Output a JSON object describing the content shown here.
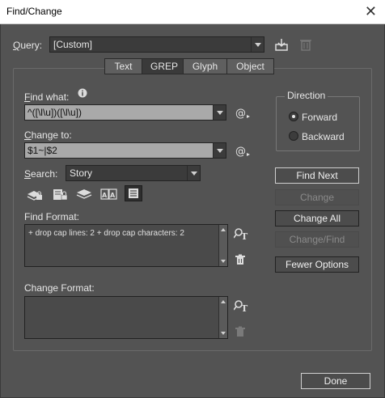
{
  "window": {
    "title": "Find/Change",
    "close_glyph": "✕"
  },
  "query": {
    "label": "Query:",
    "value": "[Custom]"
  },
  "tabs": [
    {
      "label": "Text",
      "active": false
    },
    {
      "label": "GREP",
      "active": true
    },
    {
      "label": "Glyph",
      "active": false
    },
    {
      "label": "Object",
      "active": false
    }
  ],
  "find_what": {
    "label": "Find what:",
    "value": "^([\\l\\u])([\\l\\u])",
    "info_icon": "info-icon"
  },
  "change_to": {
    "label": "Change to:",
    "value": "$1~|$2"
  },
  "search": {
    "label": "Search:",
    "value": "Story"
  },
  "direction": {
    "title": "Direction",
    "options": [
      {
        "label": "Forward",
        "selected": true
      },
      {
        "label": "Backward",
        "selected": false
      }
    ]
  },
  "buttons": {
    "find_next": "Find Next",
    "change": "Change",
    "change_all": "Change All",
    "change_find": "Change/Find",
    "fewer_options": "Fewer Options",
    "done": "Done"
  },
  "find_format": {
    "label": "Find Format:",
    "value": "+ drop cap lines:  2 + drop cap characters:  2"
  },
  "change_format": {
    "label": "Change Format:",
    "value": ""
  },
  "colors": {
    "background": "#535353",
    "field": "#a9a9a9",
    "dark_field": "#3b3b3b"
  }
}
